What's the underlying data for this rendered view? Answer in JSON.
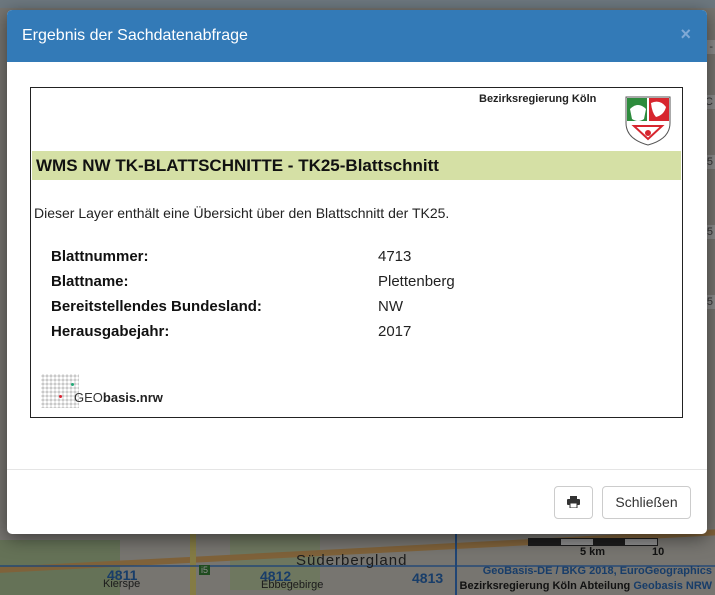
{
  "map": {
    "grid_labels": [
      "4811",
      "4812",
      "4813"
    ],
    "places": [
      "Kierspe",
      "Ebbegebirge",
      "Süderbergland"
    ],
    "road_shield": "i5",
    "scale": {
      "mid": "5 km",
      "end": "10"
    },
    "side_labels": [
      "-",
      "C",
      "5",
      "5",
      "5"
    ],
    "attribution_line1": "GeoBasis-DE / BKG 2018, EuroGeographics",
    "attribution_line2_prefix": "Bezirksregierung Köln Abteilung",
    "attribution_line2_link": "Geobasis NRW"
  },
  "modal": {
    "title": "Ergebnis der Sachdatenabfrage",
    "close_symbol": "×",
    "authority": "Bezirksregierung Köln",
    "layer_title": "WMS NW TK-BLATTSCHNITTE - TK25-Blattschnitt",
    "description": "Dieser Layer enthält eine Übersicht über den Blattschnitt der TK25.",
    "attributes": [
      {
        "key": "Blattnummer:",
        "value": "4713"
      },
      {
        "key": "Blattname:",
        "value": "Plettenberg"
      },
      {
        "key": "Bereitstellendes Bundesland:",
        "value": "NW"
      },
      {
        "key": "Herausgabejahr:",
        "value": "2017"
      }
    ],
    "logo_text_a": "GEO",
    "logo_text_b": "basis.nrw"
  },
  "footer": {
    "print_icon": "printer-icon",
    "close_label": "Schließen"
  },
  "colors": {
    "header": "#337ab7",
    "title_band": "#d5e0a5",
    "map_label": "#2d6fc0"
  }
}
